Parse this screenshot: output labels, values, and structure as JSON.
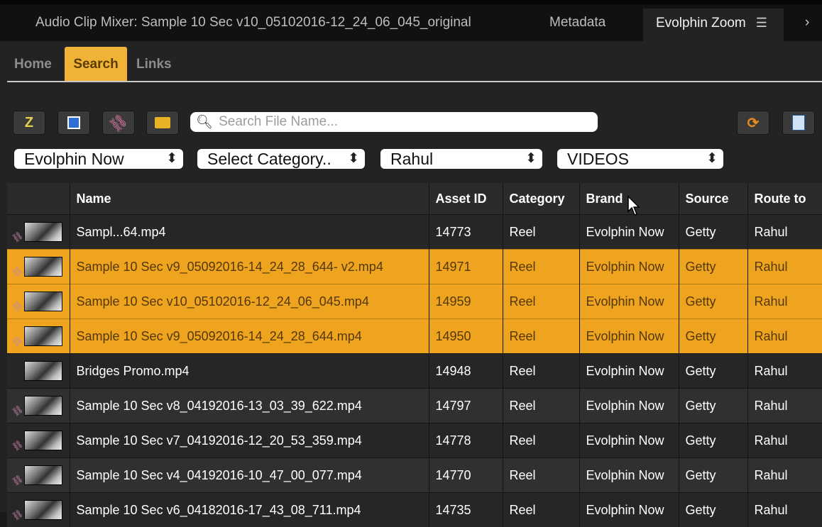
{
  "panel_tabs": [
    {
      "label": "Audio Clip Mixer: Sample 10 Sec v10_05102016-12_24_06_045_original"
    },
    {
      "label": "Metadata"
    },
    {
      "label": "Evolphin Zoom"
    }
  ],
  "sub_tabs": [
    {
      "label": "Home"
    },
    {
      "label": "Search"
    },
    {
      "label": "Links"
    }
  ],
  "toolbar": {
    "icons": [
      "checkout-icon",
      "import-icon",
      "link-icon",
      "folder-icon"
    ],
    "right_icons": [
      "refresh-icon",
      "preview-icon"
    ]
  },
  "search": {
    "placeholder": "Search File Name..."
  },
  "filters": [
    {
      "value": "Evolphin Now"
    },
    {
      "value": "Select Category.."
    },
    {
      "value": "Rahul"
    },
    {
      "value": "VIDEOS"
    }
  ],
  "table": {
    "columns": [
      "",
      "Name",
      "Asset ID",
      "Category",
      "Brand",
      "Source",
      "Route to"
    ],
    "rows": [
      {
        "name": "Sampl...64.mp4",
        "asset_id": "14773",
        "category": "Reel",
        "brand": "Evolphin Now",
        "source": "Getty",
        "route": "Rahul"
      },
      {
        "name": "Sample 10 Sec v9_05092016-14_24_28_644- v2.mp4",
        "asset_id": "14971",
        "category": "Reel",
        "brand": "Evolphin Now",
        "source": "Getty",
        "route": "Rahul"
      },
      {
        "name": "Sample 10 Sec v10_05102016-12_24_06_045.mp4",
        "asset_id": "14959",
        "category": "Reel",
        "brand": "Evolphin Now",
        "source": "Getty",
        "route": "Rahul"
      },
      {
        "name": "Sample 10 Sec v9_05092016-14_24_28_644.mp4",
        "asset_id": "14950",
        "category": "Reel",
        "brand": "Evolphin Now",
        "source": "Getty",
        "route": "Rahul"
      },
      {
        "name": "Bridges Promo.mp4",
        "asset_id": "14948",
        "category": "Reel",
        "brand": "Evolphin Now",
        "source": "Getty",
        "route": "Rahul"
      },
      {
        "name": "Sample 10 Sec v8_04192016-13_03_39_622.mp4",
        "asset_id": "14797",
        "category": "Reel",
        "brand": "Evolphin Now",
        "source": "Getty",
        "route": "Rahul"
      },
      {
        "name": "Sample 10 Sec v7_04192016-12_20_53_359.mp4",
        "asset_id": "14778",
        "category": "Reel",
        "brand": "Evolphin Now",
        "source": "Getty",
        "route": "Rahul"
      },
      {
        "name": "Sample 10 Sec v4_04192016-10_47_00_077.mp4",
        "asset_id": "14770",
        "category": "Reel",
        "brand": "Evolphin Now",
        "source": "Getty",
        "route": "Rahul"
      },
      {
        "name": "Sample 10 Sec v6_04182016-17_43_08_711.mp4",
        "asset_id": "14735",
        "category": "Reel",
        "brand": "Evolphin Now",
        "source": "Getty",
        "route": "Rahul"
      }
    ]
  },
  "colors": {
    "accent": "#f0b338",
    "selected_row": "#eea41f"
  }
}
